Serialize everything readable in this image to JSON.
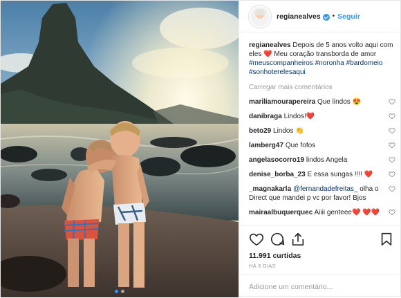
{
  "header": {
    "username": "regianealves",
    "separator": "•",
    "follow_label": "Seguir"
  },
  "caption": {
    "username": "regianealves",
    "text_1": "Depois de 5 anos volto aqui com eles",
    "emoji_1": "❤️",
    "text_2": "Meu coração transborda de amor",
    "tags": [
      "#meuscompanheiros",
      "#noronha",
      "#bardomeio",
      "#sonhoterelesaqui"
    ]
  },
  "load_more": "Carregar mais comentários",
  "comments": [
    {
      "user": "mariliamourapereira",
      "text": "Que lindos 😍"
    },
    {
      "user": "danibraga",
      "text": "Lindos!❤️"
    },
    {
      "user": "beto29",
      "text": "Lindos 👏"
    },
    {
      "user": "lamberg47",
      "text": "Que fofos"
    },
    {
      "user": "angelasocorro19",
      "text": "lindos Angela"
    },
    {
      "user": "denise_borba_23",
      "text": "E essa sungas !!!! ❤️"
    },
    {
      "user": "_magnakarla",
      "mention": "@fernandadefreitas_",
      "text": "olha o Direct que mandei p vc por favor! Bjos"
    },
    {
      "user": "mairaalbuquerquec",
      "text": "Aiiii genteee❤️ ❤️❤️"
    }
  ],
  "likes": "11.991 curtidas",
  "time": "HÁ 6 DIAS",
  "add_comment_placeholder": "Adicione um comentário...",
  "carousel": {
    "count": 2,
    "active": 0
  },
  "colors": {
    "link": "#3897f0",
    "tag": "#003569",
    "muted": "#999999",
    "heart": "#e0245e"
  },
  "icons": {
    "like": "heart-outline-icon",
    "comment": "speech-bubble-icon",
    "share": "share-icon",
    "save": "bookmark-icon",
    "verified": "verified-badge-icon",
    "comment_like": "heart-outline-small-icon"
  }
}
